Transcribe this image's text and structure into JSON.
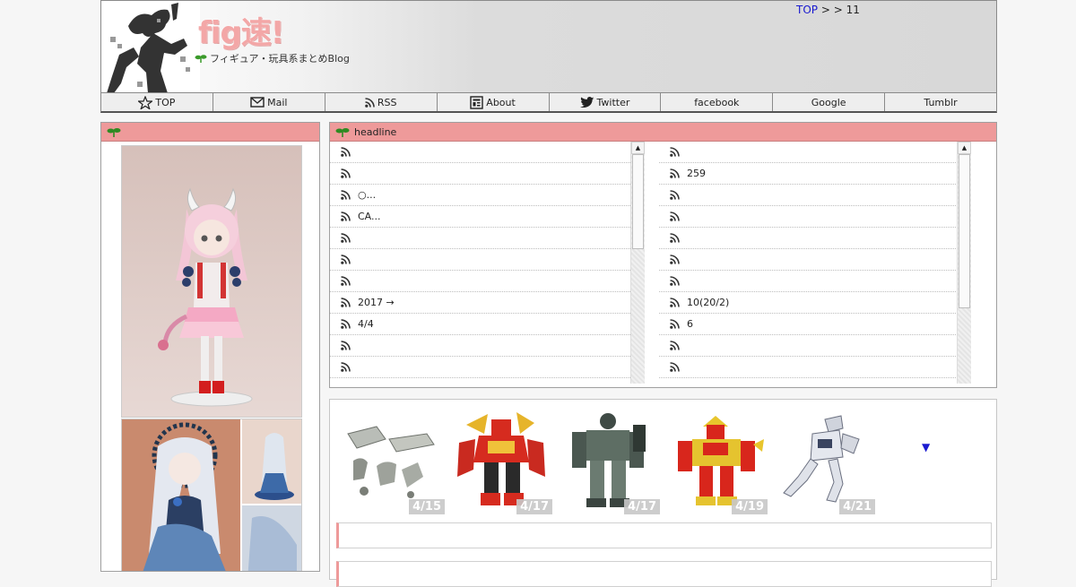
{
  "header": {
    "logo": "fig速!",
    "tagline": "フィギュア・玩具系まとめBlog",
    "breadcrumb": {
      "top": "TOP",
      "sep1": ">",
      "sep2": ">",
      "current": "11"
    }
  },
  "nav": [
    {
      "label": "TOP",
      "icon": "star-icon"
    },
    {
      "label": "Mail",
      "icon": "mail-icon"
    },
    {
      "label": "RSS",
      "icon": "rss-icon"
    },
    {
      "label": "About",
      "icon": "about-icon"
    },
    {
      "label": "Twitter",
      "icon": "twitter-bird-icon"
    },
    {
      "label": "facebook",
      "icon": ""
    },
    {
      "label": "Google",
      "icon": ""
    },
    {
      "label": "Tumblr",
      "icon": ""
    }
  ],
  "side": {
    "header_label": ""
  },
  "headline": {
    "title": "headline",
    "left": [
      "",
      "",
      "○...",
      "CA...",
      "",
      "",
      "",
      "2017 →",
      "4/4",
      "",
      ""
    ],
    "right": [
      "",
      "259",
      "",
      "",
      "",
      "",
      "",
      "10(20/2)",
      "6",
      "",
      ""
    ],
    "left_scroll_position": 0.0,
    "right_scroll_position": 0.0
  },
  "products": [
    {
      "date": "4/15",
      "kind": "gray-parts"
    },
    {
      "date": "4/17",
      "kind": "red-gold-robot"
    },
    {
      "date": "4/17",
      "kind": "green-robot"
    },
    {
      "date": "4/19",
      "kind": "red-yellow-robot"
    },
    {
      "date": "4/21",
      "kind": "white-robot"
    }
  ],
  "more_arrow": "▼",
  "colors": {
    "accent_pink": "#ee9a9a",
    "link_blue": "#1a1ad0",
    "leaf_green": "#3a9a2a"
  }
}
